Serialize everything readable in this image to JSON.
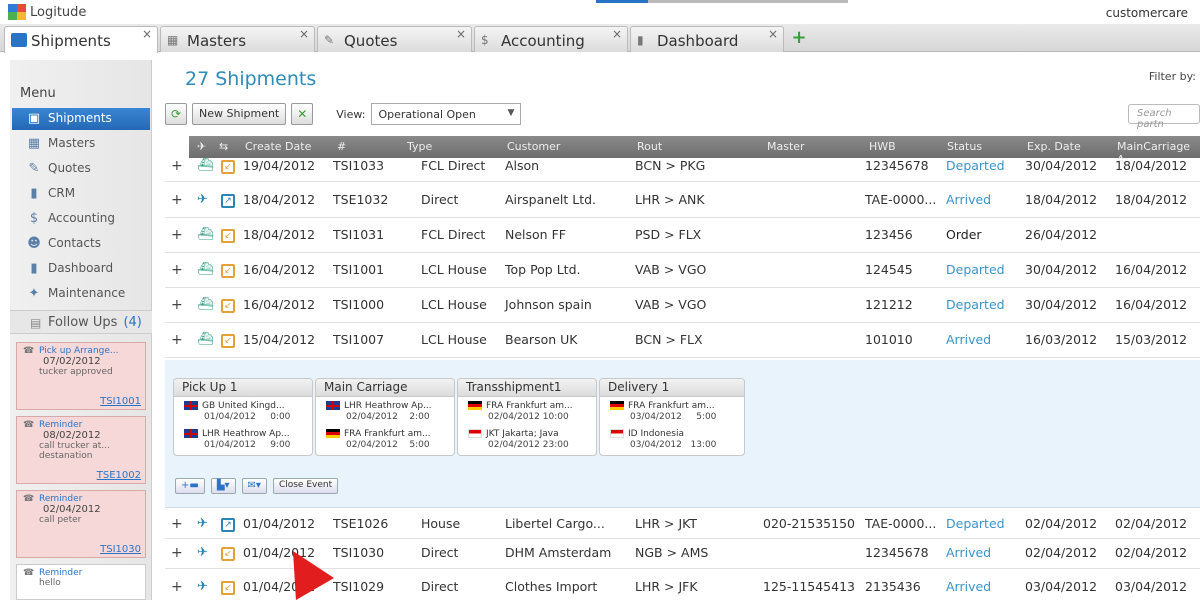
{
  "app": {
    "logo_text": "Logitude",
    "user": "customercare"
  },
  "tabs": [
    {
      "label": "Shipments",
      "icon": "shipments-icon",
      "active": true
    },
    {
      "label": "Masters",
      "icon": "masters-icon"
    },
    {
      "label": "Quotes",
      "icon": "quotes-icon"
    },
    {
      "label": "Accounting",
      "icon": "accounting-icon"
    },
    {
      "label": "Dashboard",
      "icon": "dashboard-icon"
    }
  ],
  "tab_close": "×",
  "tab_add": "+",
  "sidebar": {
    "title": "Menu",
    "items": [
      {
        "label": "Shipments",
        "icon": "shipments-icon"
      },
      {
        "label": "Masters",
        "icon": "masters-icon"
      },
      {
        "label": "Quotes",
        "icon": "quotes-icon"
      },
      {
        "label": "CRM",
        "icon": "crm-icon"
      },
      {
        "label": "Accounting",
        "icon": "accounting-icon"
      },
      {
        "label": "Contacts",
        "icon": "contacts-icon"
      },
      {
        "label": "Dashboard",
        "icon": "dashboard-icon"
      },
      {
        "label": "Maintenance",
        "icon": "wrench-icon"
      }
    ],
    "followups_label": "Follow Ups",
    "followups_count": "(4)",
    "notes": [
      {
        "title": "Pick up Arrange...",
        "date": "07/02/2012",
        "text": "tucker approved",
        "link": "TSI1001"
      },
      {
        "title": "Reminder",
        "date": "08/02/2012",
        "text": "call trucker at... destanation",
        "link": "TSE1002"
      },
      {
        "title": "Reminder",
        "date": "02/04/2012",
        "text": "call peter",
        "link": "TSI1030"
      },
      {
        "title": "Reminder",
        "date": "",
        "text": "hello",
        "link": ""
      }
    ]
  },
  "main": {
    "title": "27 Shipments",
    "filter_label": "Filter by:",
    "new_button": "New Shipment",
    "view_label": "View:",
    "view_value": "Operational Open",
    "search_placeholder": "Search partn",
    "columns": [
      "Create Date",
      "#",
      "Type",
      "Customer",
      "Rout",
      "Master",
      "HWB",
      "Status",
      "Exp. Date",
      "MainCarriage A"
    ],
    "rows_top": [
      {
        "date": "19/04/2012",
        "num": "TSI1033",
        "type": "FCL Direct",
        "customer": "Alson",
        "rout": "BCN > PKG",
        "master": "",
        "hwb": "12345678",
        "status": "Departed",
        "exp": "30/04/2012",
        "main": "18/04/2012",
        "mode": "sea"
      },
      {
        "date": "18/04/2012",
        "num": "TSE1032",
        "type": "Direct",
        "customer": "Airspanelt Ltd.",
        "rout": "LHR > ANK",
        "master": "",
        "hwb": "TAE-0000...",
        "status": "Arrived",
        "exp": "18/04/2012",
        "main": "18/04/2012",
        "mode": "air"
      },
      {
        "date": "18/04/2012",
        "num": "TSI1031",
        "type": "FCL Direct",
        "customer": "Nelson FF",
        "rout": "PSD > FLX",
        "master": "",
        "hwb": "123456",
        "status": "Order",
        "exp": "26/04/2012",
        "main": "",
        "mode": "sea"
      },
      {
        "date": "16/04/2012",
        "num": "TSI1001",
        "type": "LCL House",
        "customer": "Top Pop Ltd.",
        "rout": "VAB > VGO",
        "master": "",
        "hwb": "124545",
        "status": "Departed",
        "exp": "30/04/2012",
        "main": "16/04/2012",
        "mode": "sea"
      },
      {
        "date": "16/04/2012",
        "num": "TSI1000",
        "type": "LCL House",
        "customer": "Johnson spain",
        "rout": "VAB > VGO",
        "master": "",
        "hwb": "121212",
        "status": "Departed",
        "exp": "30/04/2012",
        "main": "16/04/2012",
        "mode": "sea"
      },
      {
        "date": "15/04/2012",
        "num": "TSI1007",
        "type": "LCL House",
        "customer": "Bearson UK",
        "rout": "BCN > FLX",
        "master": "",
        "hwb": "101010",
        "status": "Arrived",
        "exp": "16/03/2012",
        "main": "15/03/2012",
        "mode": "sea"
      }
    ],
    "rows_bottom": [
      {
        "date": "01/04/2012",
        "num": "TSE1026",
        "type": "House",
        "customer": "Libertel Cargo...",
        "rout": "LHR > JKT",
        "master": "020-21535150",
        "hwb": "TAE-0000...",
        "status": "Departed",
        "exp": "02/04/2012",
        "main": "02/04/2012",
        "mode": "air"
      },
      {
        "date": "01/04/2012",
        "num": "TSI1030",
        "type": "Direct",
        "customer": "DHM Amsterdam",
        "rout": "NGB > AMS",
        "master": "",
        "hwb": "12345678",
        "status": "Arrived",
        "exp": "02/04/2012",
        "main": "02/04/2012",
        "mode": "air"
      },
      {
        "date": "01/04/2012",
        "num": "TSI1029",
        "type": "Direct",
        "customer": "Clothes Import",
        "rout": "LHR > JFK",
        "master": "125-11545413",
        "hwb": "2135436",
        "status": "Arrived",
        "exp": "03/04/2012",
        "main": "03/04/2012",
        "mode": "air"
      }
    ],
    "detail": {
      "stages": [
        {
          "title": "Pick Up 1",
          "l1": "GB United Kingd...",
          "d1": "01/04/2012",
          "t1": "0:00",
          "l2": "LHR Heathrow Ap...",
          "d2": "01/04/2012",
          "t2": "9:00"
        },
        {
          "title": "Main Carriage",
          "l1": "LHR Heathrow Ap...",
          "d1": "02/04/2012",
          "t1": "2:00",
          "l2": "FRA Frankfurt am...",
          "d2": "02/04/2012",
          "t2": "5:00"
        },
        {
          "title": "Transshipment1",
          "l1": "FRA Frankfurt am...",
          "d1": "02/04/2012",
          "t1": "10:00",
          "l2": "JKT Jakarta; Java",
          "d2": "02/04/2012",
          "t2": "23:00"
        },
        {
          "title": "Delivery 1",
          "l1": "FRA Frankfurt am...",
          "d1": "03/04/2012",
          "t1": "5:00",
          "l2": "ID Indonesia",
          "d2": "03/04/2012",
          "t2": "13:00"
        }
      ],
      "close_event": "Close Event"
    }
  }
}
